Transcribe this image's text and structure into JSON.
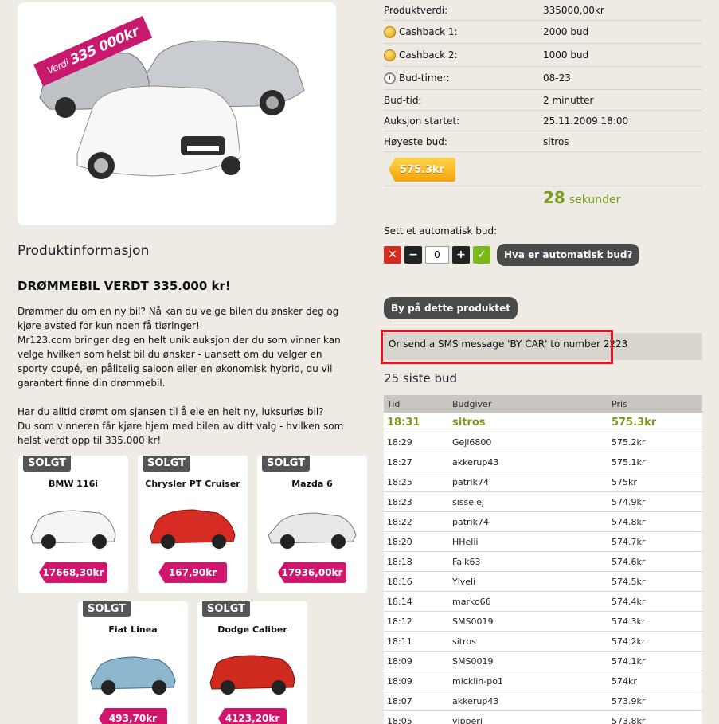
{
  "hero": {
    "banner_prefix": "Verdi",
    "banner_value": "335 000kr"
  },
  "product_info": {
    "section_title": "Produktinformasjon",
    "heading": "DRØMMEBIL VERDT 335.000 kr!",
    "description": "Drømmer du om en ny bil? Nå kan du velge bilen du ønsker deg og kjøre avsted for kun noen få tiøringer!\nMr123.com bringer deg en helt unik auksjon der du som vinner kan velge hvilken som helst bil du ønsker - uansett om du velger en sporty coupé, en pålitelig saloon eller en økonomisk hybrid, du vil garantert finne din drømmebil.\n\nHar du alltid drømt om sjansen til å eie en helt ny, luksuriøs bil?\nDu som vinneren får kjøre hjem med bilen av ditt valg - hvilken som helst verdt opp til 335.000 kr!"
  },
  "sold_items": [
    {
      "tag": "SOLGT",
      "name": "BMW 116i",
      "price": "17668,30kr",
      "color": "#f4f4f4"
    },
    {
      "tag": "SOLGT",
      "name": "Chrysler PT Cruiser",
      "price": "167,90kr",
      "color": "#d62b22"
    },
    {
      "tag": "SOLGT",
      "name": "Mazda 6",
      "price": "17936,00kr",
      "color": "#e8e8e8"
    },
    {
      "tag": "SOLGT",
      "name": "Fiat Linea",
      "price": "493,70kr",
      "color": "#8fb6cf"
    },
    {
      "tag": "SOLGT",
      "name": "Dodge Caliber",
      "price": "4123,20kr",
      "color": "#cf2a1e"
    }
  ],
  "details": [
    {
      "label": "Produktverdi:",
      "value": "335000,00kr",
      "icon": ""
    },
    {
      "label": "Cashback 1:",
      "value": "2000 bud",
      "icon": "coins-icon"
    },
    {
      "label": "Cashback 2:",
      "value": "1000 bud",
      "icon": "coins-icon"
    },
    {
      "label": "Bud-timer:",
      "value": "08-23",
      "icon": "clock-icon"
    },
    {
      "label": "Bud-tid:",
      "value": "2 minutter",
      "icon": ""
    },
    {
      "label": "Auksjon startet:",
      "value": "25.11.2009 18:00",
      "icon": ""
    },
    {
      "label": "Høyeste bud:",
      "value": "sitros",
      "icon": ""
    }
  ],
  "current_bid": "575.3kr",
  "countdown": {
    "value": "28",
    "unit": "sekunder"
  },
  "auto_bid": {
    "label": "Sett et automatisk bud:",
    "quantity": "0",
    "help_button": "Hva er automatisk bud?"
  },
  "buy_button": "By på dette produktet",
  "sms_text": "Or send a SMS message 'BY CAR' to number 2223",
  "last_bids": {
    "title": "25 siste bud",
    "headers": [
      "Tid",
      "Budgiver",
      "Pris"
    ],
    "rows": [
      [
        "18:31",
        "sitros",
        "575.3kr"
      ],
      [
        "18:29",
        "Gejl6800",
        "575.2kr"
      ],
      [
        "18:27",
        "akkerup43",
        "575.1kr"
      ],
      [
        "18:25",
        "patrik74",
        "575kr"
      ],
      [
        "18:23",
        "sisselej",
        "574.9kr"
      ],
      [
        "18:22",
        "patrik74",
        "574.8kr"
      ],
      [
        "18:20",
        "HHelii",
        "574.7kr"
      ],
      [
        "18:18",
        "Falk63",
        "574.6kr"
      ],
      [
        "18:16",
        "Ylveli",
        "574.5kr"
      ],
      [
        "18:14",
        "marko66",
        "574.4kr"
      ],
      [
        "18:12",
        "SMS0019",
        "574.3kr"
      ],
      [
        "18:11",
        "sitros",
        "574.2kr"
      ],
      [
        "18:09",
        "SMS0019",
        "574.1kr"
      ],
      [
        "18:09",
        "micklin-po1",
        "574kr"
      ],
      [
        "18:07",
        "akkerup43",
        "573.9kr"
      ],
      [
        "18:05",
        "yipperi",
        "573.8kr"
      ]
    ]
  }
}
